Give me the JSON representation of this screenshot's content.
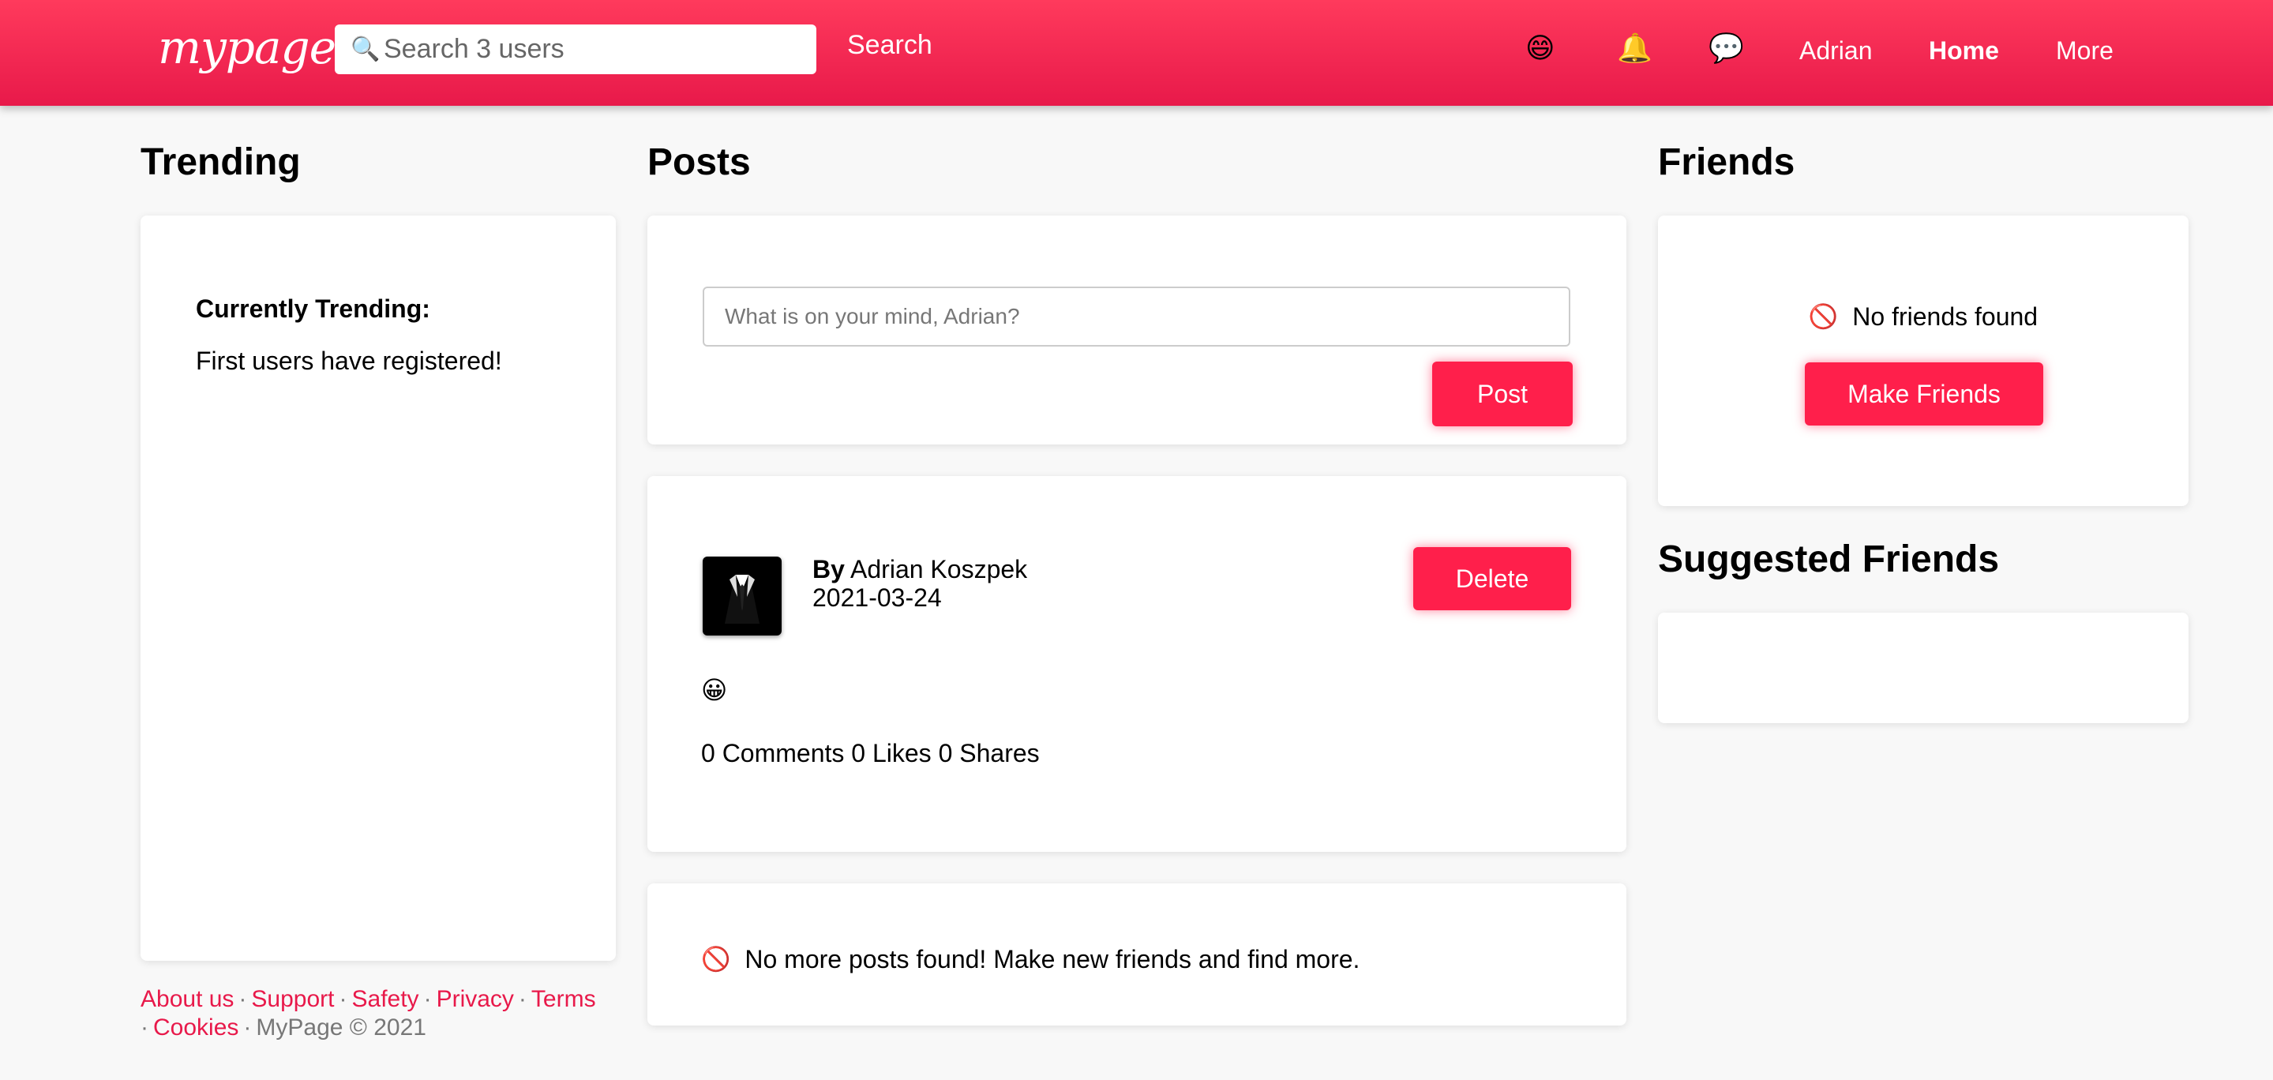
{
  "header": {
    "logo": "mypage",
    "search_placeholder": "Search 3 users",
    "search_label": "Search",
    "search_icon": "🔍",
    "emoji_icon": "😄",
    "bell_icon": "🔔",
    "chat_icon": "💬",
    "user_label": "Adrian",
    "home_label": "Home",
    "more_label": "More"
  },
  "trending": {
    "heading": "Trending",
    "title": "Currently Trending:",
    "text": "First users have registered!"
  },
  "posts": {
    "heading": "Posts",
    "composer_placeholder": "What is on your mind, Adrian?",
    "post_button": "Post",
    "items": [
      {
        "by_label": "By",
        "author": "Adrian Koszpek",
        "date": "2021-03-24",
        "body": "😀",
        "stats": "0 Comments 0 Likes 0 Shares",
        "delete_label": "Delete"
      }
    ],
    "no_more_icon": "🚫",
    "no_more_text": "No more posts found! Make new friends and find more."
  },
  "friends": {
    "heading": "Friends",
    "empty_icon": "🚫",
    "empty_text": "No friends found",
    "make_friends_button": "Make Friends"
  },
  "suggested": {
    "heading": "Suggested Friends"
  },
  "footer": {
    "links": [
      "About us",
      "Support",
      "Safety",
      "Privacy",
      "Terms",
      "Cookies"
    ],
    "copyright": "MyPage © 2021"
  },
  "colors": {
    "accent": "#ff1f4b",
    "header_top": "#ff3a5c",
    "header_bottom": "#e8194a",
    "background": "#f8f8f8"
  }
}
